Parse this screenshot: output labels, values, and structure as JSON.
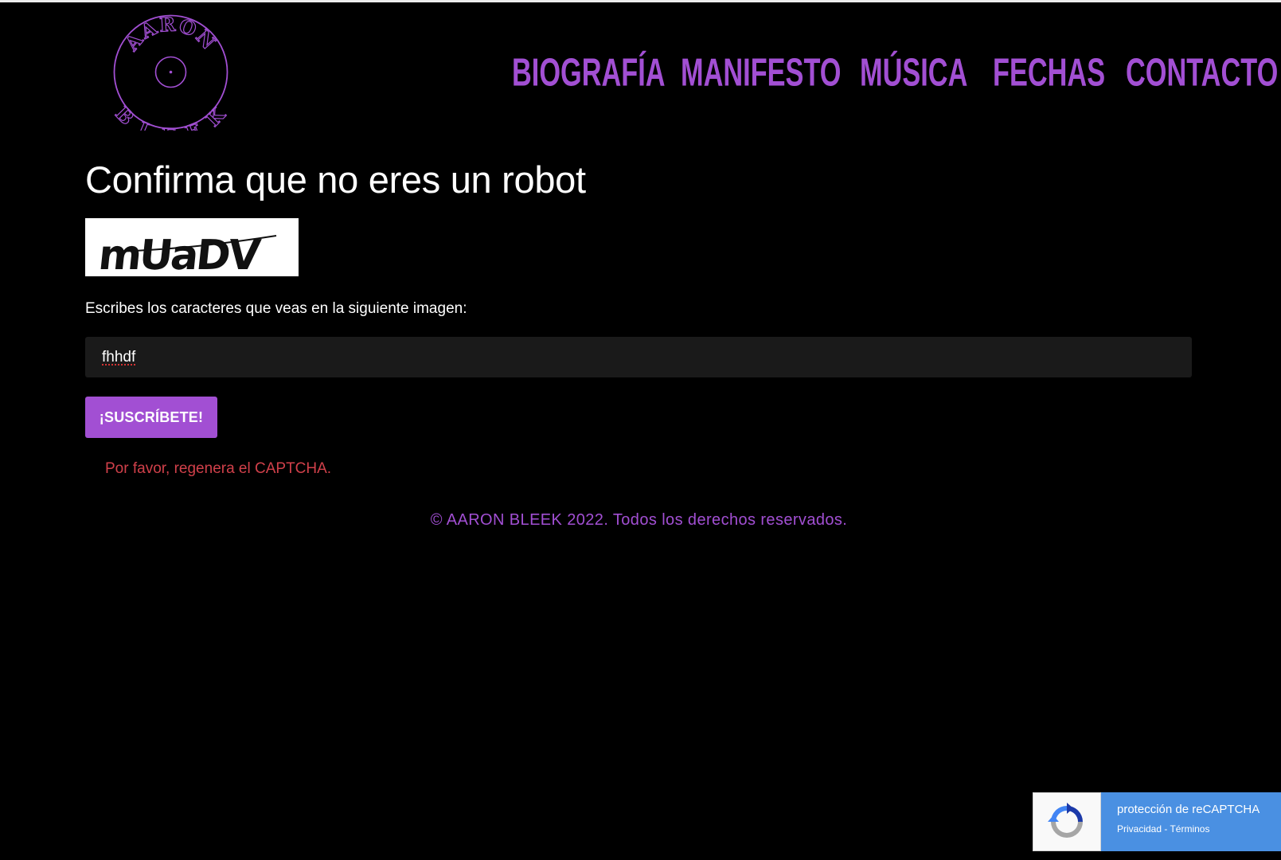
{
  "brand": {
    "logo_text_top": "AARON",
    "logo_text_bottom": "BLEEK",
    "accent": "#a24fd3"
  },
  "nav": {
    "items": [
      {
        "label": "BIOGRAFÍA"
      },
      {
        "label": "MANIFESTO"
      },
      {
        "label": "MÚSICA"
      },
      {
        "label": "FECHAS"
      },
      {
        "label": "CONTACTO"
      }
    ]
  },
  "form": {
    "title": "Confirma que no eres un robot",
    "captcha_text": "mUaDV",
    "prompt": "Escribes los caracteres que veas en la siguiente imagen:",
    "input_value": "fhhdf",
    "submit_label": "¡SUSCRÍBETE!",
    "error": "Por favor, regenera el CAPTCHA."
  },
  "footer": {
    "copyright": "© AARON BLEEK 2022. Todos los derechos reservados."
  },
  "recaptcha": {
    "title": "protección de reCAPTCHA",
    "links": "Privacidad - Términos"
  }
}
